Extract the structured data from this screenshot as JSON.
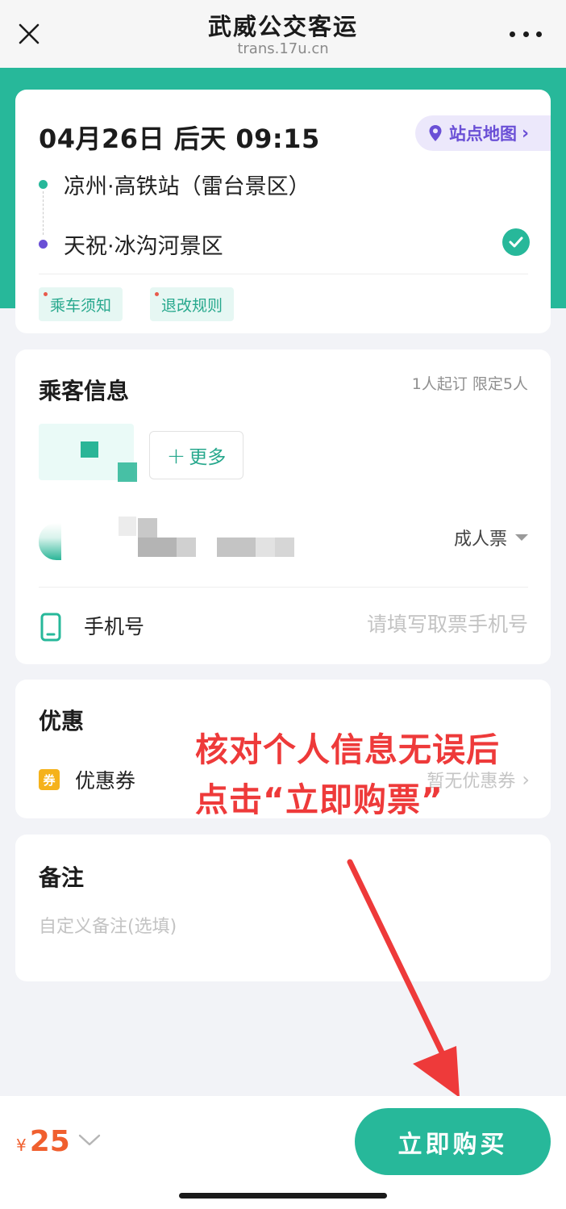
{
  "navbar": {
    "title": "武威公交客运",
    "url": "trans.17u.cn",
    "close_icon": "close-icon",
    "more_icon": "more-dots-icon"
  },
  "trip": {
    "datetime": "04月26日 后天 09:15",
    "map_button": "站点地图",
    "start_stop": "凉州·高铁站（雷台景区）",
    "end_stop": "天祝·冰沟河景区",
    "tags": [
      "乘车须知",
      "退改规则"
    ],
    "colors": {
      "start_dot": "#27b89a",
      "end_dot": "#6a4fd6"
    }
  },
  "passenger": {
    "title": "乘客信息",
    "limit": "1人起订  限定5人",
    "more_button": "更多",
    "ticket_type": "成人票",
    "phone_label": "手机号",
    "phone_placeholder": "请填写取票手机号",
    "phone_value": ""
  },
  "discount": {
    "title": "优惠",
    "coupon_icon_text": "券",
    "coupon_label": "优惠券",
    "coupon_value": "暂无优惠券"
  },
  "remark": {
    "title": "备注",
    "placeholder": "自定义备注(选填)",
    "value": ""
  },
  "annotation": {
    "line1": "核对个人信息无误后",
    "line2": "点击“立即购票”"
  },
  "bottom": {
    "currency": "¥",
    "price": "25",
    "buy_button": "立即购买"
  },
  "colors": {
    "brand": "#27b89a",
    "price": "#f05f2e",
    "annotation": "#ee3a3a",
    "accent_purple": "#6a4fd6"
  }
}
